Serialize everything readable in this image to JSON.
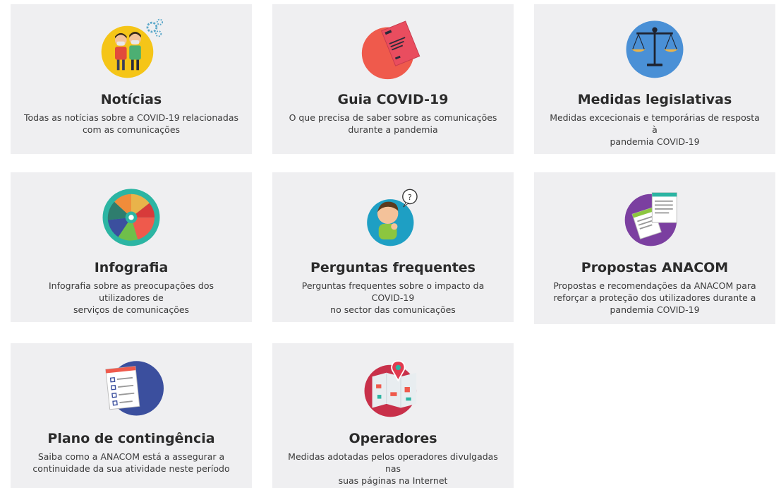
{
  "cards": [
    {
      "title": "Notícias",
      "desc_lines": [
        "Todas as notícias sobre a COVID-19 relacionadas",
        "com as comunicações"
      ],
      "icon": "people-masks-icon",
      "icon_color": "#f5c518"
    },
    {
      "title": "Guia COVID-19",
      "desc_lines": [
        "O que precisa de saber sobre as comunicações",
        "durante a pandemia"
      ],
      "icon": "guide-booklet-icon",
      "icon_color": "#ef5a4c"
    },
    {
      "title": "Medidas legislativas",
      "desc_lines": [
        "Medidas excecionais e temporárias de resposta à",
        "pandemia COVID-19"
      ],
      "icon": "scales-icon",
      "icon_color": "#4a90d6"
    },
    {
      "title": "Infografia",
      "desc_lines": [
        "Infografia sobre as preocupações dos utilizadores de",
        "serviços de comunicações"
      ],
      "icon": "infographic-wheel-icon",
      "icon_color": "#2cb5a3"
    },
    {
      "title": "Perguntas frequentes",
      "desc_lines": [
        "Perguntas frequentes sobre o impacto da COVID-19",
        "no sector das comunicações"
      ],
      "icon": "thinking-person-icon",
      "icon_color": "#1e9fc4"
    },
    {
      "title": "Propostas ANACOM",
      "desc_lines": [
        "Propostas e recomendações da ANACOM para",
        "reforçar a proteção dos utilizadores durante a",
        "pandemia COVID-19"
      ],
      "icon": "documents-icon",
      "icon_color": "#7b3fa0"
    },
    {
      "title": "Plano de contingência",
      "desc_lines": [
        "Saiba como a ANACOM está a assegurar a",
        "continuidade da sua atividade neste período"
      ],
      "icon": "checklist-icon",
      "icon_color": "#3b4f9e"
    },
    {
      "title": "Operadores",
      "desc_lines": [
        "Medidas adotadas pelos operadores divulgadas nas",
        "suas páginas na Internet"
      ],
      "icon": "map-pin-icon",
      "icon_color": "#c8304a"
    }
  ]
}
